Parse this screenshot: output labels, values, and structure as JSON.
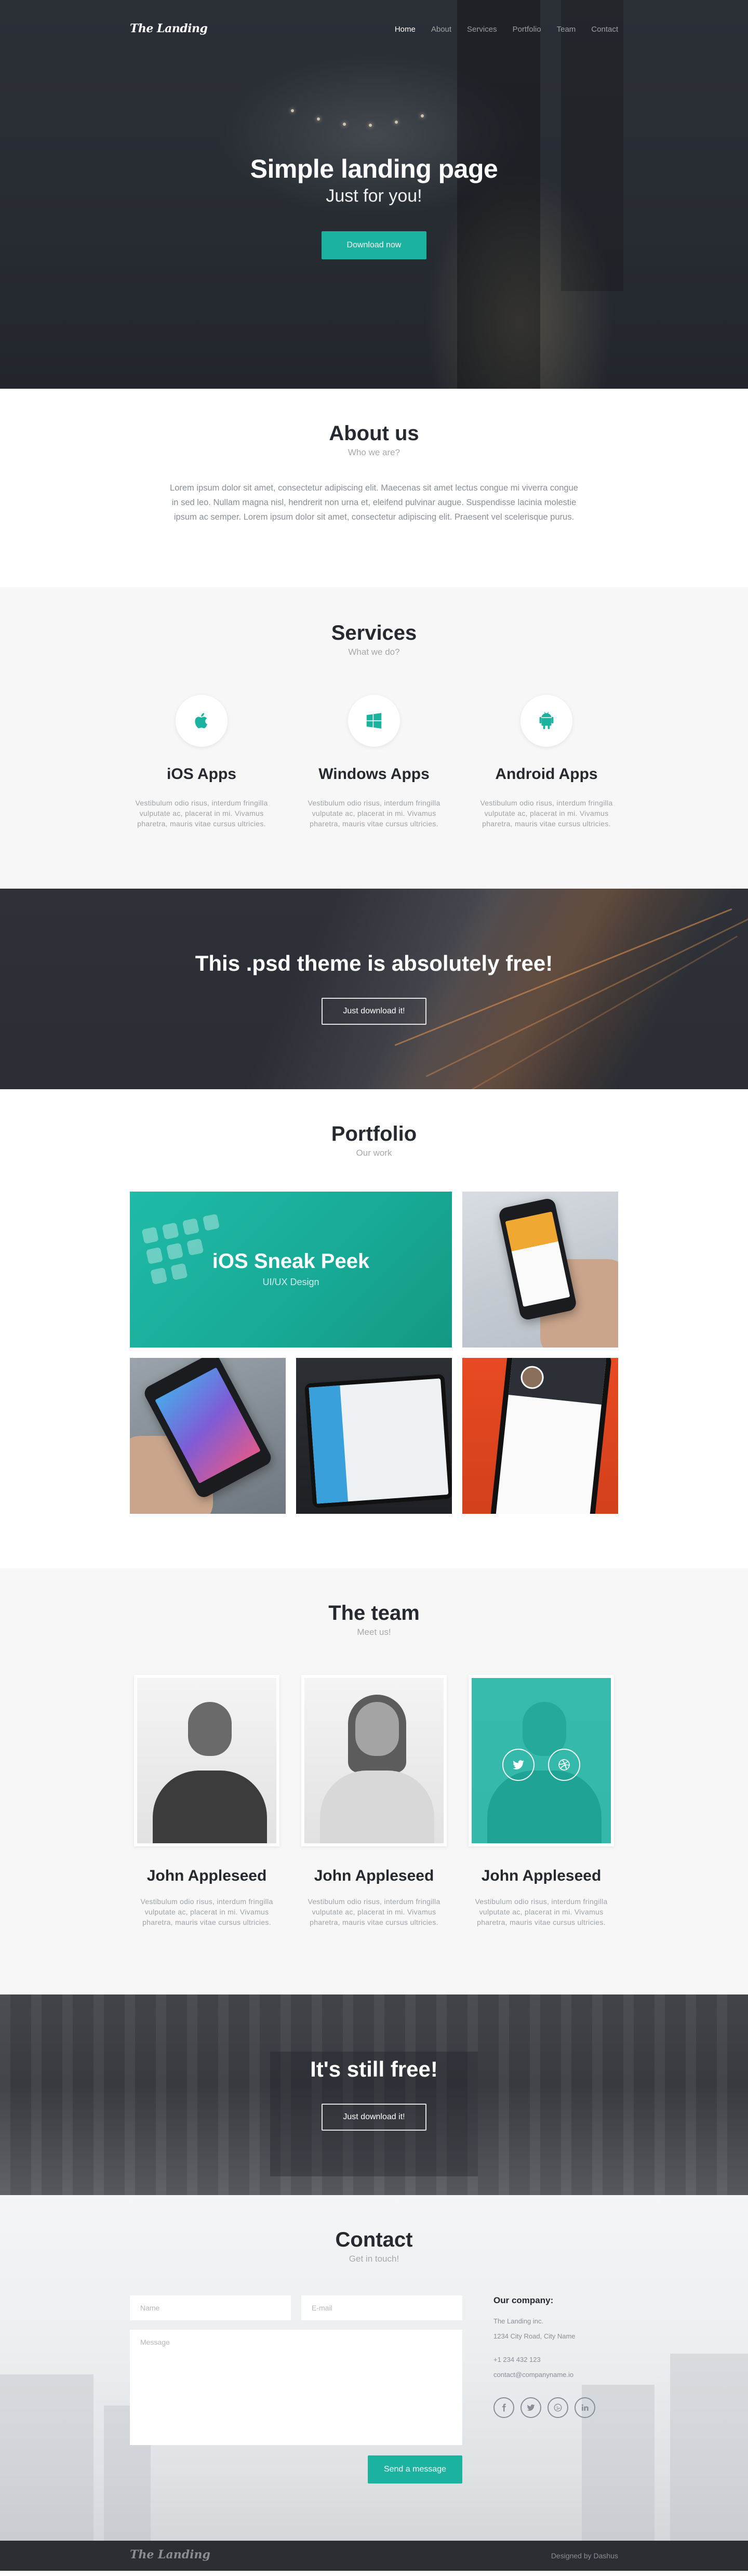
{
  "nav": {
    "logo": "The Landing",
    "items": [
      {
        "label": "Home",
        "active": true
      },
      {
        "label": "About"
      },
      {
        "label": "Services"
      },
      {
        "label": "Portfolio"
      },
      {
        "label": "Team"
      },
      {
        "label": "Contact"
      }
    ]
  },
  "hero": {
    "title": "Simple landing page",
    "subtitle": "Just for you!",
    "button": "Download now"
  },
  "about": {
    "title": "About us",
    "subtitle": "Who we are?",
    "text": "Lorem ipsum dolor sit amet, consectetur adipiscing elit. Maecenas sit amet lectus congue mi viverra congue in sed leo. Nullam magna nisl, hendrerit non urna et, eleifend pulvinar augue. Suspendisse lacinia molestie ipsum ac semper. Lorem ipsum dolor sit amet, consectetur adipiscing elit. Praesent vel scelerisque purus."
  },
  "services": {
    "title": "Services",
    "subtitle": "What we do?",
    "items": [
      {
        "icon": "apple-icon",
        "name": "iOS Apps",
        "text": "Vestibulum odio risus, interdum fringilla vulputate ac, placerat in mi. Vivamus pharetra, mauris vitae cursus ultricies."
      },
      {
        "icon": "windows-icon",
        "name": "Windows Apps",
        "text": "Vestibulum odio risus, interdum fringilla vulputate ac, placerat in mi. Vivamus pharetra, mauris vitae cursus ultricies."
      },
      {
        "icon": "android-icon",
        "name": "Android Apps",
        "text": "Vestibulum odio risus, interdum fringilla vulputate ac, placerat in mi. Vivamus pharetra, mauris vitae cursus ultricies."
      }
    ]
  },
  "banner1": {
    "title": "This .psd theme is absolutely free!",
    "button": "Just download it!"
  },
  "portfolio": {
    "title": "Portfolio",
    "subtitle": "Our work",
    "featured_title": "iOS Sneak Peek",
    "featured_sub": "UI/UX Design"
  },
  "team": {
    "title": "The team",
    "subtitle": "Meet us!",
    "members": [
      {
        "name": "John Appleseed",
        "text": "Vestibulum odio risus, interdum fringilla vulputate ac, placerat in mi. Vivamus pharetra, mauris vitae cursus ultricies."
      },
      {
        "name": "John Appleseed",
        "text": "Vestibulum odio risus, interdum fringilla vulputate ac, placerat in mi. Vivamus pharetra, mauris vitae cursus ultricies."
      },
      {
        "name": "John Appleseed",
        "text": "Vestibulum odio risus, interdum fringilla vulputate ac, placerat in mi. Vivamus pharetra, mauris vitae cursus ultricies."
      }
    ]
  },
  "banner2": {
    "title": "It's still free!",
    "button": "Just download it!"
  },
  "contact": {
    "title": "Contact",
    "subtitle": "Get in touch!",
    "name_placeholder": "Name",
    "email_placeholder": "E-mail",
    "message_placeholder": "Message",
    "button": "Send a message",
    "company_title": "Our company:",
    "company_name": "The Landing inc.",
    "address": "1234 City Road, City Name",
    "phone": "+1 234 432 123",
    "email": "contact@companyname.io"
  },
  "footer": {
    "logo": "The Landing",
    "credit": "Designed by Dashus"
  },
  "colors": {
    "accent": "#1bb2a0",
    "dark": "#2b2e33"
  }
}
